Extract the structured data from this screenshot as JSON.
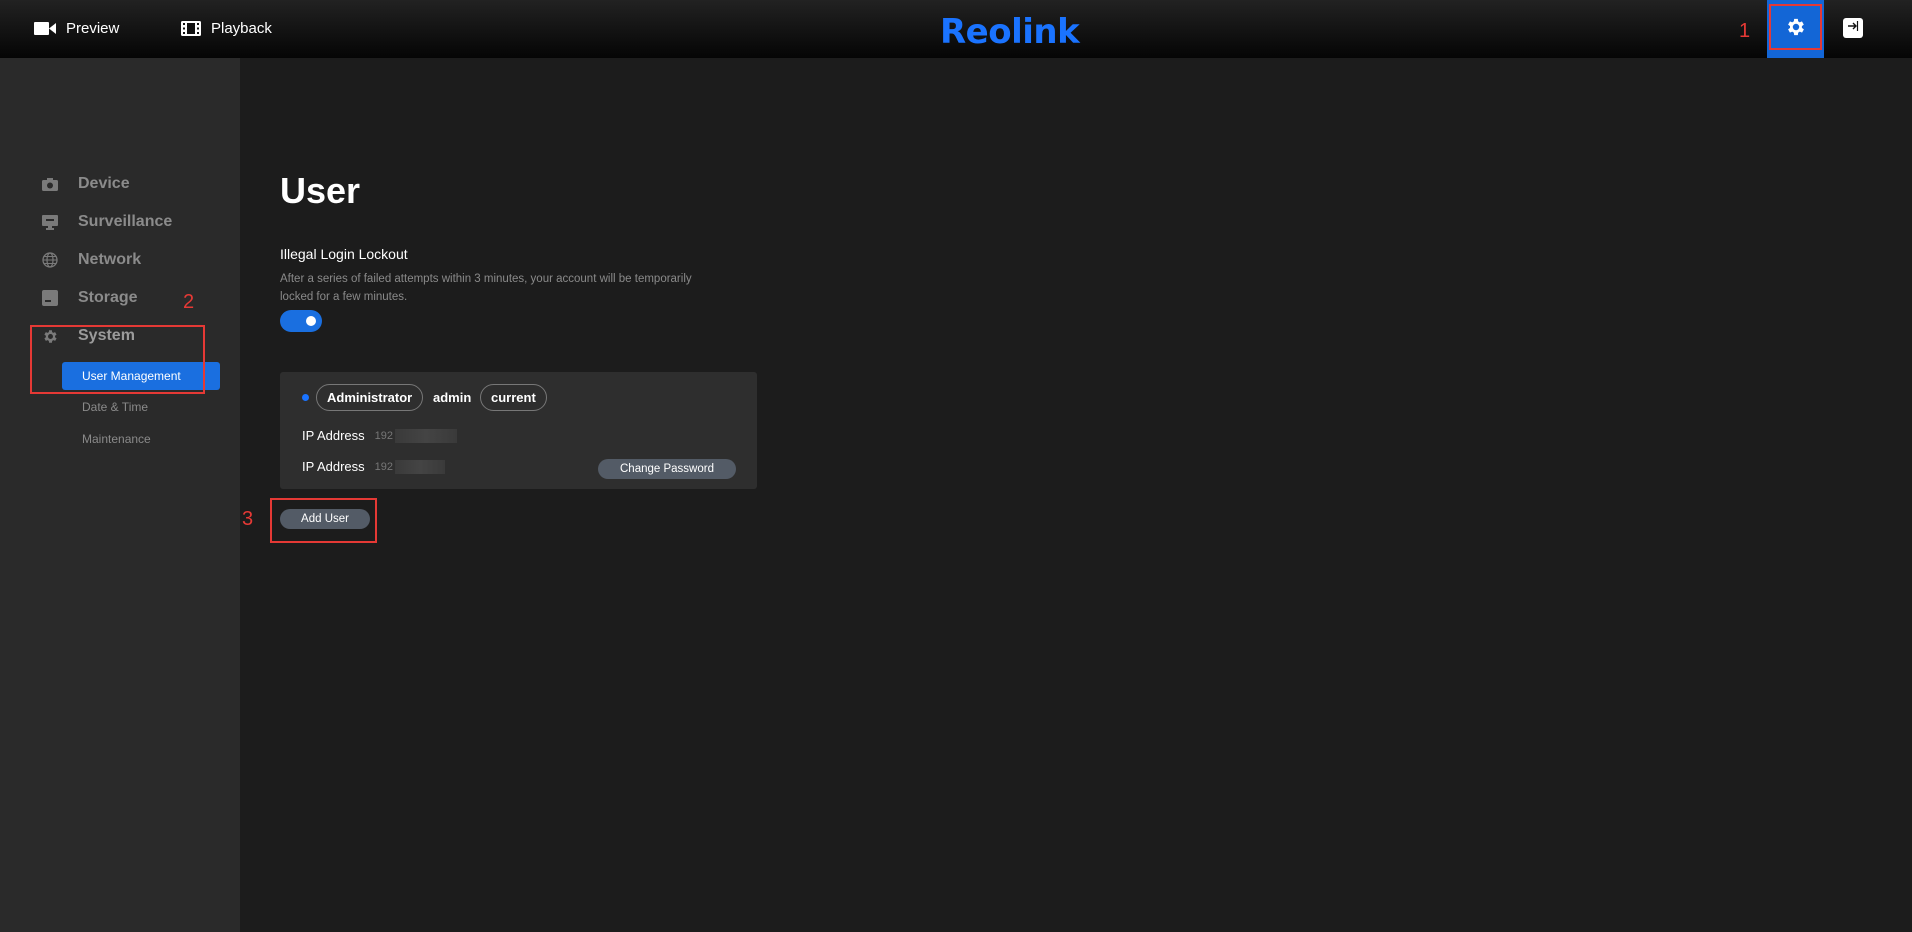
{
  "topbar": {
    "preview_label": "Preview",
    "playback_label": "Playback",
    "logo_text": "Reolink",
    "accent_color": "#1a73ff"
  },
  "sidebar": {
    "items": [
      {
        "label": "Device",
        "icon": "camera-icon"
      },
      {
        "label": "Surveillance",
        "icon": "monitor-icon"
      },
      {
        "label": "Network",
        "icon": "globe-icon"
      },
      {
        "label": "Storage",
        "icon": "storage-icon"
      },
      {
        "label": "System",
        "icon": "gear-icon"
      }
    ],
    "sub_items": [
      {
        "label": "User Management",
        "active": true
      },
      {
        "label": "Date & Time"
      },
      {
        "label": "Maintenance"
      }
    ]
  },
  "main": {
    "title": "User",
    "lockout": {
      "title": "Illegal Login Lockout",
      "description": "After a series of failed attempts within 3 minutes, your account will be temporarily locked for a few minutes.",
      "enabled": true
    },
    "user_card": {
      "role": "Administrator",
      "username": "admin",
      "status": "current",
      "ip_rows": [
        {
          "label": "IP Address",
          "value": "192"
        },
        {
          "label": "IP Address",
          "value": "192"
        }
      ],
      "change_password_label": "Change Password"
    },
    "add_user_label": "Add User"
  },
  "annotations": [
    "1",
    "2",
    "3"
  ]
}
